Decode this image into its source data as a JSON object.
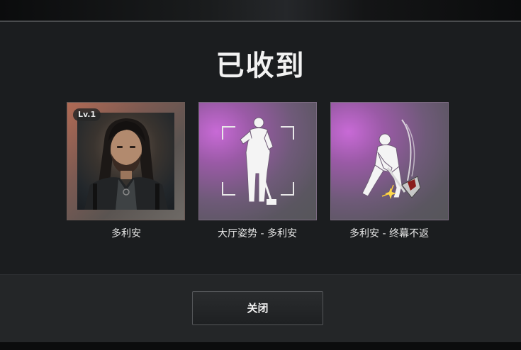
{
  "dialog": {
    "title": "已收到",
    "rewards": [
      {
        "label": "多利安",
        "badge": "Lv.1",
        "icon": "character-portrait"
      },
      {
        "label": "大厅姿势 - 多利安",
        "icon": "lobby-pose-icon"
      },
      {
        "label": "多利安 - 终幕不返",
        "icon": "finisher-emote-icon"
      }
    ],
    "close_label": "关闭"
  },
  "colors": {
    "panel": "#1b1d1f",
    "footer": "#242628",
    "text": "#f2f2f2",
    "card_purple": "#9a5aa6"
  }
}
